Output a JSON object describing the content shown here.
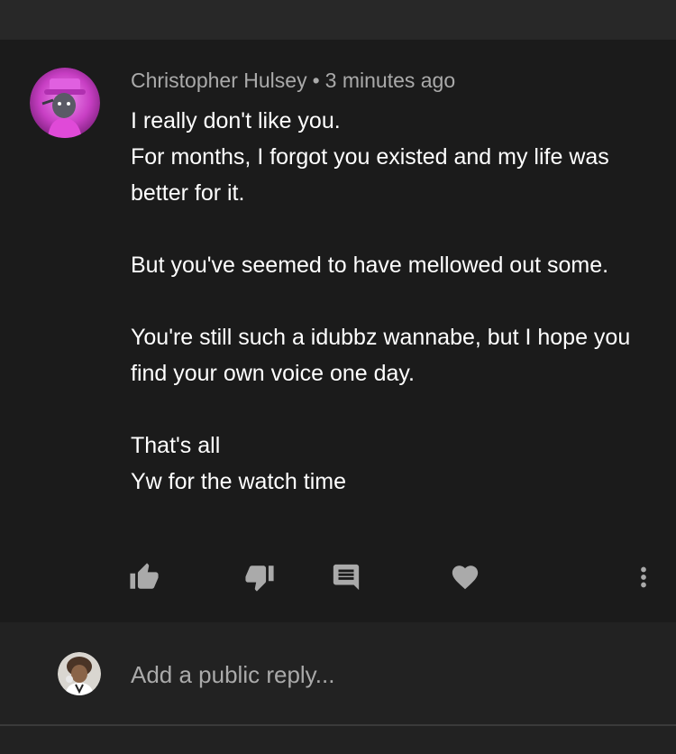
{
  "comment": {
    "author": "Christopher Hulsey",
    "separator": "•",
    "timestamp": "3 minutes ago",
    "lines": {
      "l1": "I really don't like you.",
      "l2": "For months, I forgot you existed and my life was better for it.",
      "l3": "But you've seemed to have mellowed out some.",
      "l4": "You're still such a idubbz wannabe, but I hope you find your own voice one day.",
      "l5": "That's all",
      "l6": "Yw for the watch time"
    },
    "actions": {
      "like_icon": "thumb-up-icon",
      "dislike_icon": "thumb-down-icon",
      "reply_icon": "comment-icon",
      "heart_icon": "heart-icon",
      "more_icon": "more-vert-icon"
    }
  },
  "reply": {
    "placeholder": "Add a public reply..."
  },
  "colors": {
    "background": "#222222",
    "card": "#1b1b1b",
    "text": "#ffffff",
    "secondary_text": "#aaaaaa",
    "icon": "#aaaaaa",
    "avatar_accent": "#d63bc8"
  }
}
